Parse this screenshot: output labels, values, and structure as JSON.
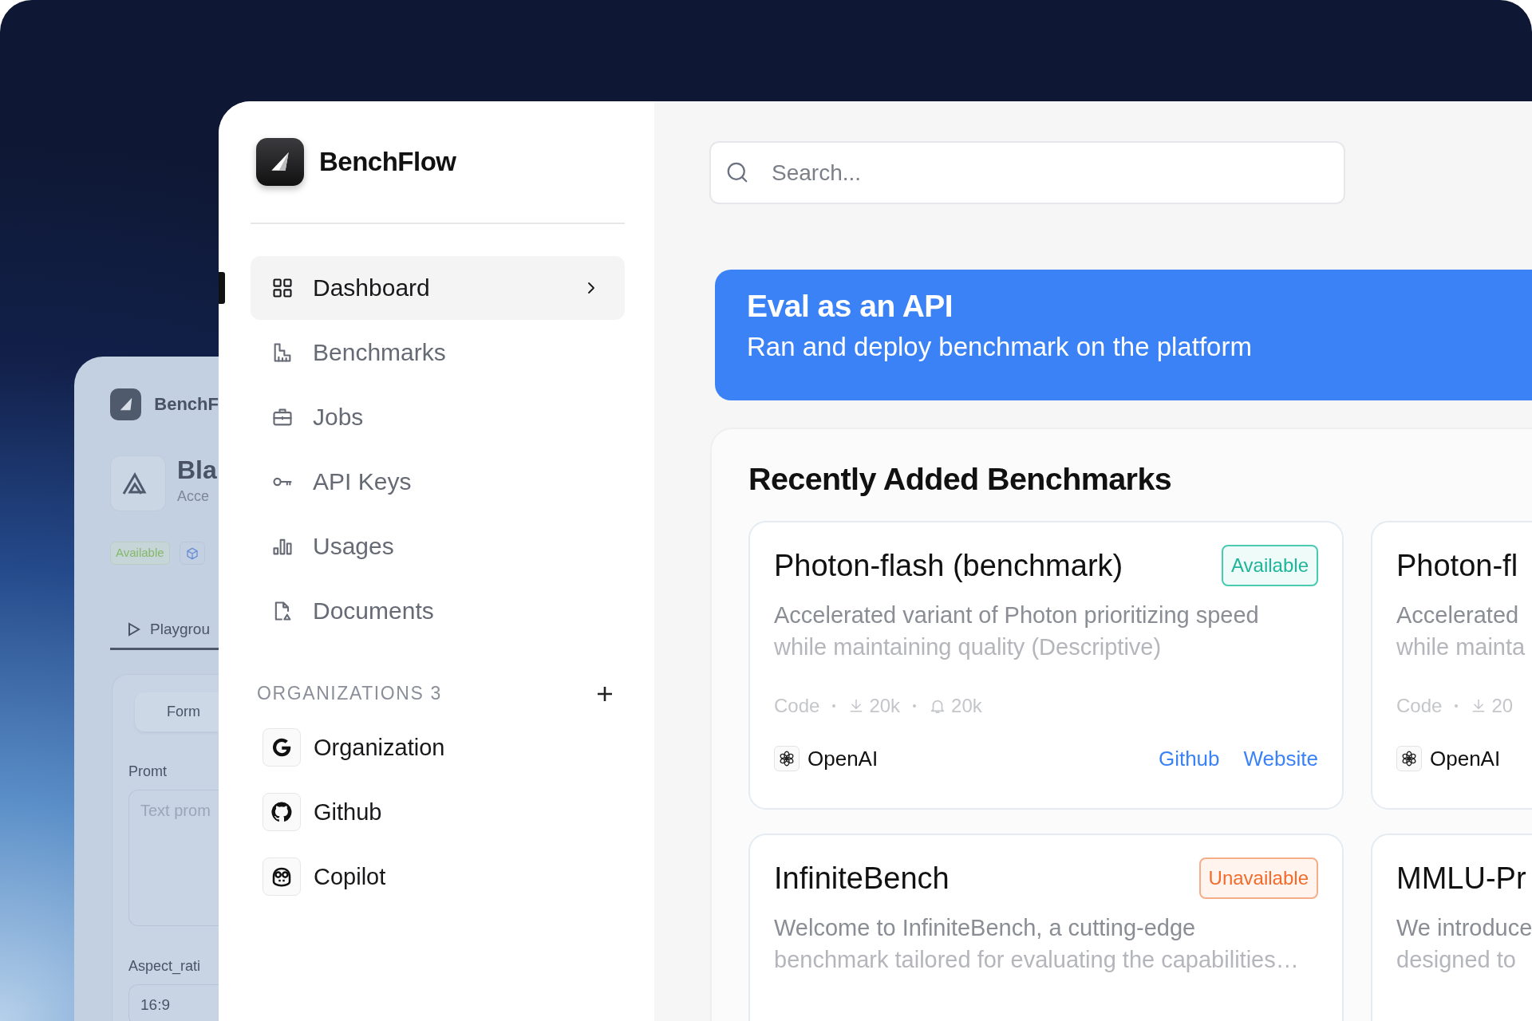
{
  "back_window": {
    "brand": "BenchF",
    "title": "Bla",
    "subtitle": "Acce",
    "status": "Available",
    "tab": {
      "label": "Playgrou",
      "selected": true
    },
    "form_button": "Form",
    "prompt_label": "Promt",
    "prompt_placeholder": "Text prom",
    "aspect_label": "Aspect_rati",
    "aspect_value": "16:9"
  },
  "sidebar": {
    "brand": "BenchFlow",
    "nav": [
      {
        "label": "Dashboard",
        "selected": true
      },
      {
        "label": "Benchmarks",
        "selected": false
      },
      {
        "label": "Jobs",
        "selected": false
      },
      {
        "label": "API Keys",
        "selected": false
      },
      {
        "label": "Usages",
        "selected": false
      },
      {
        "label": "Documents",
        "selected": false
      }
    ],
    "organizations": {
      "heading": "ORGANIZATIONS 3",
      "items": [
        {
          "label": "Organization"
        },
        {
          "label": "Github"
        },
        {
          "label": "Copilot"
        }
      ]
    }
  },
  "search": {
    "placeholder": "Search..."
  },
  "banner": {
    "title": "Eval as an API",
    "subtitle": "Ran and deploy benchmark on the platform"
  },
  "recent": {
    "heading": "Recently Added Benchmarks",
    "cards": [
      {
        "title": "Photon-flash (benchmark)",
        "status": {
          "label": "Available",
          "kind": "available"
        },
        "description": [
          "Accelerated variant of Photon prioritizing speed",
          "while maintaining quality (Descriptive)"
        ],
        "meta": {
          "source": "Code",
          "downloads": "20k",
          "likes": "20k"
        },
        "provider": "OpenAI",
        "links": [
          "Github",
          "Website"
        ]
      },
      {
        "title": "Photon-fl",
        "description": [
          "Accelerated",
          "while mainta"
        ],
        "meta": {
          "source": "Code",
          "downloads": "20"
        },
        "provider": "OpenAI"
      },
      {
        "title": "InfiniteBench",
        "status": {
          "label": "Unavailable",
          "kind": "unavailable"
        },
        "description": [
          "Welcome to InfiniteBench, a cutting-edge",
          "benchmark tailored for evaluating the capabilities…"
        ]
      },
      {
        "title": "MMLU-Pr",
        "description": [
          "We introduce",
          "designed to"
        ]
      }
    ]
  }
}
